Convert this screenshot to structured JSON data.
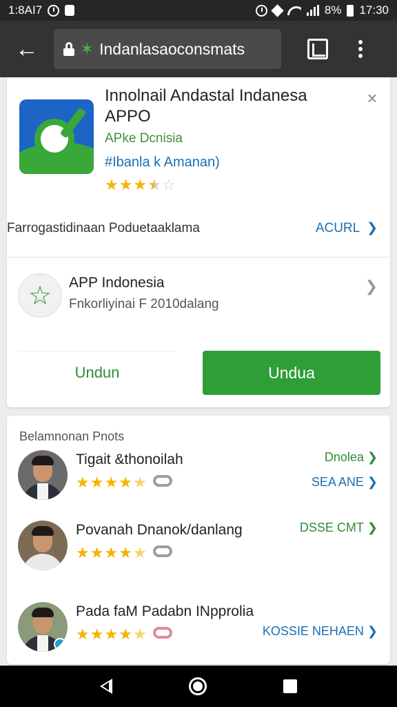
{
  "status_bar": {
    "time_left": "1:8AI7",
    "battery_text": "8%",
    "time_right": "17:30"
  },
  "toolbar": {
    "back_icon": "arrow-left-icon",
    "url": "Indanlasaoconsmats",
    "url_prefix_icon": "star-icon"
  },
  "app_card": {
    "title": "Innolnail Andastal Indanesa APPO",
    "developer": "APke Dcnisia",
    "category": "#Ibanla k Amanan)",
    "rating_stars": 3.5,
    "promo_text": "Farrogastidinaan Poduetaaklama",
    "promo_link": "ACURL",
    "publisher_name": "APP Indonesia",
    "publisher_sub": "Fnkorliyinai F 2010dalang",
    "secondary_button": "Undun",
    "install_button": "Undua",
    "accent_color": "#2f9e36",
    "link_color": "#1a6fb5"
  },
  "reviews": {
    "header": "Belamnonan Pnots",
    "items": [
      {
        "name": "Tigait &thonoilah",
        "rating": 4.5,
        "link_top": "Dnolea",
        "link_bottom": "SEA ANE"
      },
      {
        "name": "Povanah Dnanok/danlang",
        "rating": 4.5,
        "link_top": "DSSE CMT"
      },
      {
        "name": "Pada faM Padabn INpprolia",
        "rating": 4.5,
        "link_top": "KOSSIE NEHAEN"
      }
    ]
  }
}
